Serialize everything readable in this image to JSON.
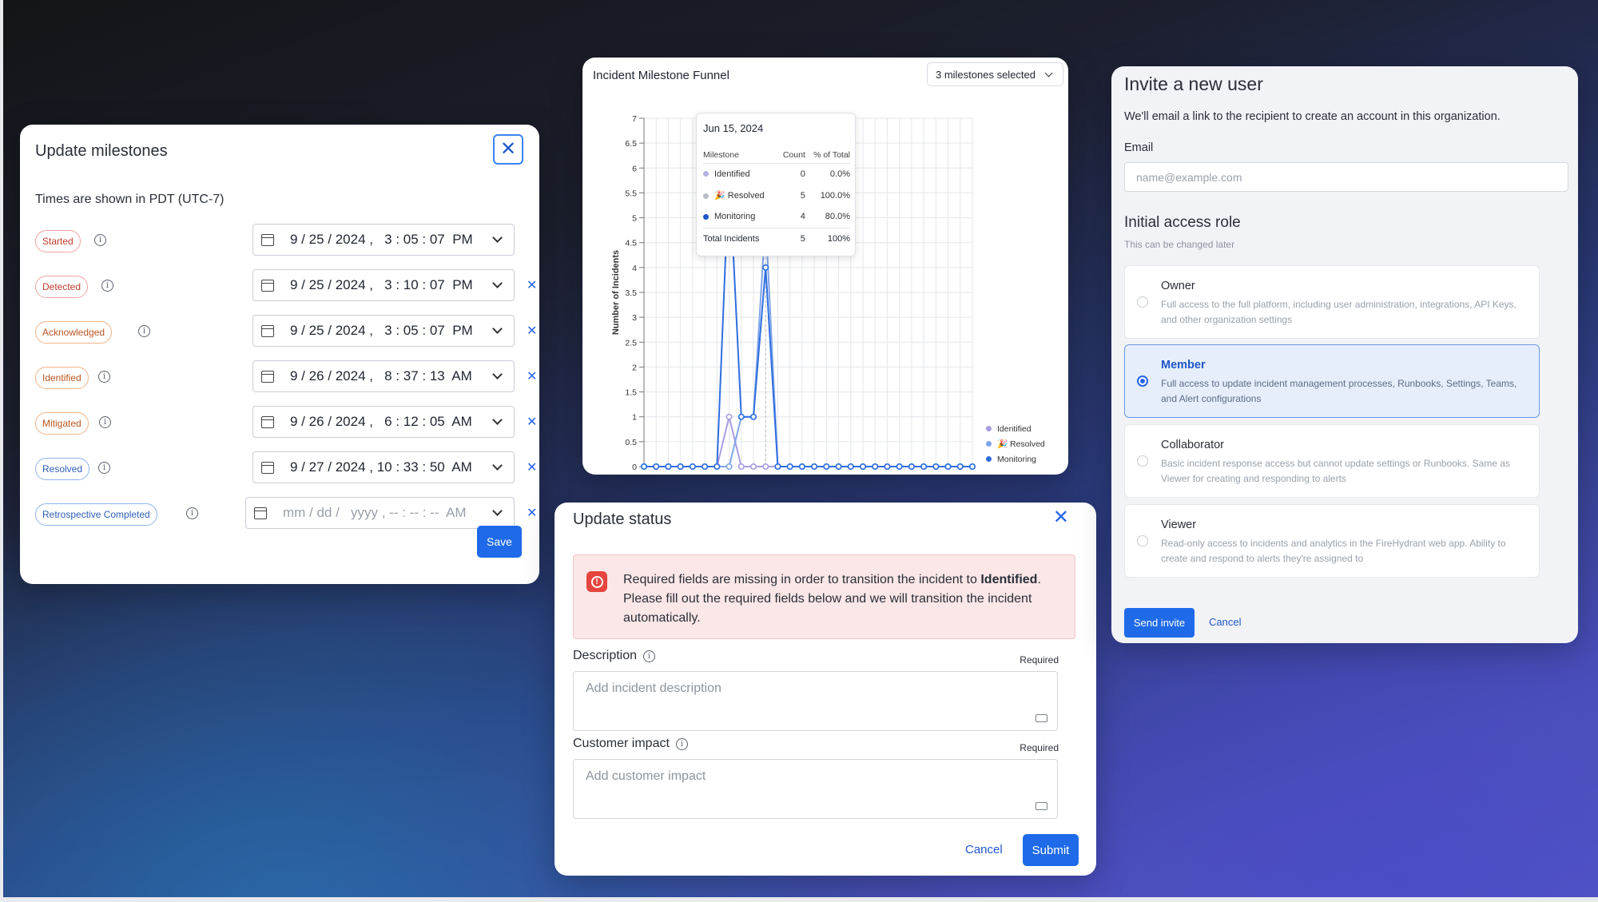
{
  "milestones": {
    "title": "Update milestones",
    "timezone_note": "Times are shown in PDT (UTC-7)",
    "save_label": "Save",
    "rows": [
      {
        "label": "Started",
        "value": "9 / 25 / 2024 ,   3 : 05 : 07  PM",
        "color": "red"
      },
      {
        "label": "Detected",
        "value": "9 / 25 / 2024 ,   3 : 10 : 07  PM",
        "color": "red"
      },
      {
        "label": "Acknowledged",
        "value": "9 / 25 / 2024 ,   3 : 05 : 07  PM",
        "color": "orange"
      },
      {
        "label": "Identified",
        "value": "9 / 26 / 2024 ,   8 : 37 : 13  AM",
        "color": "orange"
      },
      {
        "label": "Mitigated",
        "value": "9 / 26 / 2024 ,   6 : 12 : 05  AM",
        "color": "orange"
      },
      {
        "label": "Resolved",
        "value": "9 / 27 / 2024 , 10 : 33 : 50  AM",
        "color": "blue"
      },
      {
        "label": "Retrospective Completed",
        "value": "mm / dd /   yyyy , -- : -- : --  AM",
        "color": "blue"
      }
    ]
  },
  "funnel": {
    "title": "Incident Milestone Funnel",
    "selector": "3 milestones selected",
    "tooltip": {
      "date": "Jun 15, 2024",
      "headers": [
        "Milestone",
        "Count",
        "% of Total"
      ],
      "rows": [
        {
          "name": "Identified",
          "count": "0",
          "pct": "0.0%",
          "color": "#b6b3e0"
        },
        {
          "name": "🎉 Resolved",
          "count": "5",
          "pct": "100.0%",
          "color": "#b9bdc6"
        },
        {
          "name": "Monitoring",
          "count": "4",
          "pct": "80.0%",
          "color": "#1f56c8"
        }
      ],
      "total": {
        "name": "Total Incidents",
        "count": "5",
        "pct": "100%"
      }
    },
    "legend": [
      {
        "name": "Identified",
        "color": "#a99de0"
      },
      {
        "name": "🎉 Resolved",
        "color": "#7fa6ea"
      },
      {
        "name": "Monitoring",
        "color": "#2f6ee0"
      }
    ]
  },
  "chart_data": {
    "type": "line",
    "ylabel": "Number of Incidents",
    "xlabel": "",
    "ylim": [
      0,
      7
    ],
    "yticks": [
      "0",
      "0.5",
      "1",
      "1.5",
      "2",
      "2.5",
      "3",
      "3.5",
      "4",
      "4.5",
      "5",
      "5.5",
      "6",
      "6.5",
      "7"
    ],
    "x": [
      1,
      2,
      3,
      4,
      5,
      6,
      7,
      8,
      9,
      10,
      11,
      12,
      13,
      14,
      15,
      16,
      17,
      18,
      19,
      20,
      21,
      22,
      23,
      24,
      25,
      26,
      27,
      28
    ],
    "series": [
      {
        "name": "Identified",
        "color": "#a99de0",
        "values": [
          0,
          0,
          0,
          0,
          0,
          0,
          0,
          1,
          0,
          0,
          0,
          0,
          0,
          0,
          0,
          0,
          0,
          0,
          0,
          0,
          0,
          0,
          0,
          0,
          0,
          0,
          0,
          0
        ]
      },
      {
        "name": "🎉 Resolved",
        "color": "#7fa6ea",
        "values": [
          0,
          0,
          0,
          0,
          0,
          0,
          0,
          0,
          1,
          1,
          5,
          0,
          0,
          0,
          0,
          0,
          0,
          0,
          0,
          0,
          0,
          0,
          0,
          0,
          0,
          0,
          0,
          0
        ]
      },
      {
        "name": "Monitoring",
        "color": "#2f6ee0",
        "values": [
          0,
          0,
          0,
          0,
          0,
          0,
          0,
          6,
          1,
          1,
          4,
          0,
          0,
          0,
          0,
          0,
          0,
          0,
          0,
          0,
          0,
          0,
          0,
          0,
          0,
          0,
          0,
          0
        ]
      }
    ]
  },
  "status": {
    "title": "Update status",
    "alert_pre": "Required fields are missing in order to transition the incident to ",
    "alert_bold": "Identified",
    "alert_post": ". Please fill out the required fields below and we will transition the incident automatically.",
    "description_label": "Description",
    "description_required": "Required",
    "description_placeholder": "Add incident description",
    "impact_label": "Customer impact",
    "impact_required": "Required",
    "impact_placeholder": "Add customer impact",
    "cancel_label": "Cancel",
    "submit_label": "Submit"
  },
  "invite": {
    "title": "Invite a new user",
    "subtitle": "We'll email a link to the recipient to create an account in this organization.",
    "email_label": "Email",
    "email_placeholder": "name@example.com",
    "role_title": "Initial access role",
    "role_subtitle": "This can be changed later",
    "roles": [
      {
        "name": "Owner",
        "desc": "Full access to the full platform, including user administration, integrations, API Keys, and other organization settings",
        "selected": false
      },
      {
        "name": "Member",
        "desc": "Full access to update incident management processes, Runbooks, Settings, Teams, and Alert configurations",
        "selected": true
      },
      {
        "name": "Collaborator",
        "desc": "Basic incident response access but cannot update settings or Runbooks. Same as Viewer for creating and responding to alerts",
        "selected": false
      },
      {
        "name": "Viewer",
        "desc": "Read-only access to incidents and analytics in the FireHydrant web app. Ability to create and respond to alerts they're assigned to",
        "selected": false
      }
    ],
    "send_label": "Send invite",
    "cancel_label": "Cancel"
  }
}
